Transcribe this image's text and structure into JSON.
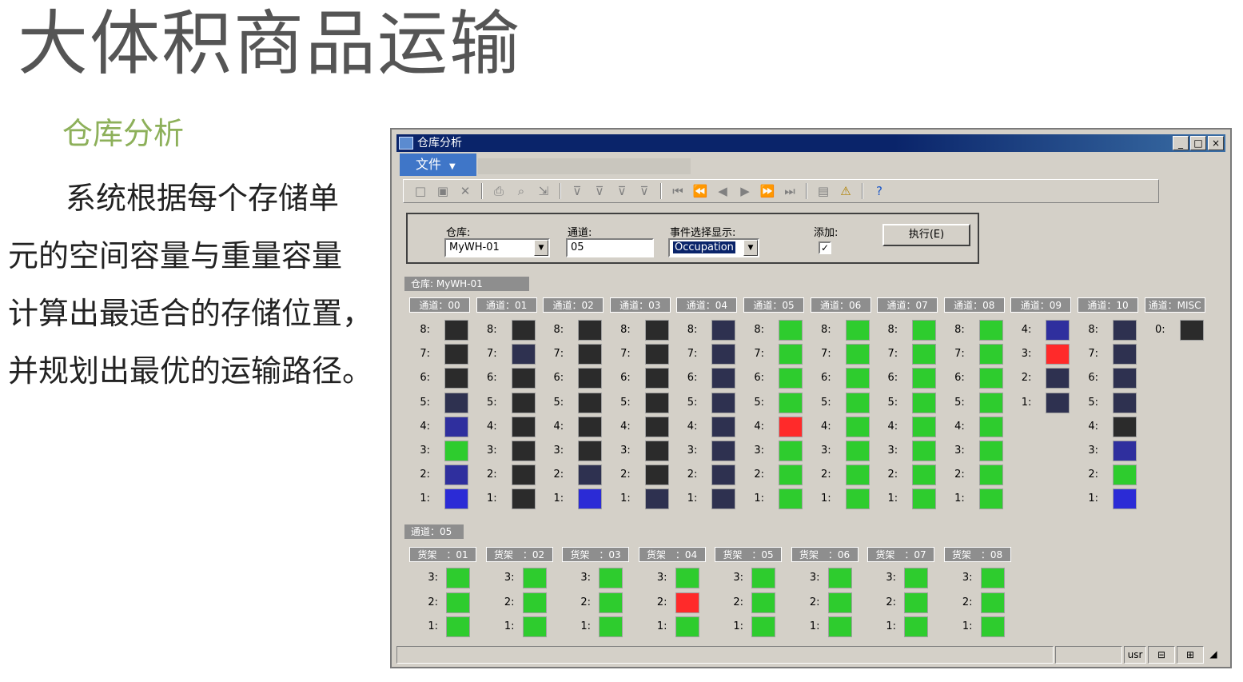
{
  "slide": {
    "title": "大体积商品运输",
    "subtitle": "仓库分析",
    "body_lines": [
      "系统根据每个存储单",
      "元的空间容量与重量容量",
      "计算出最适合的存储位置，",
      "并规划出最优的运输路径。"
    ]
  },
  "window": {
    "title": "仓库分析",
    "menu": {
      "file": "文件"
    },
    "controls": [
      "_",
      "□",
      "×"
    ]
  },
  "toolbar": {
    "icons": [
      "new-icon",
      "save-icon",
      "delete-icon",
      "|",
      "print-icon",
      "print-preview-icon",
      "export-icon",
      "|",
      "filter-icon",
      "filter-add-icon",
      "filter-edit-icon",
      "filter-remove-icon",
      "|",
      "first-icon",
      "prev-page-icon",
      "prev-icon",
      "next-icon",
      "next-page-icon",
      "last-icon",
      "|",
      "clipboard-icon",
      "alert-icon",
      "|",
      "help-icon"
    ]
  },
  "filter": {
    "warehouse_label": "仓库:",
    "warehouse_value": "MyWH-01",
    "aisle_label": "通道:",
    "aisle_value": "05",
    "event_label": "事件选择显示:",
    "event_value": "Occupation",
    "add_label": "添加:",
    "add_checked": true,
    "execute_label": "执行(E)"
  },
  "colors": {
    "dark": "#2b2b2b",
    "navy": "#2e3150",
    "blue": "#2f2f9e",
    "bright_blue": "#2b2bd6",
    "green": "#2ecc2e",
    "red": "#ff2a2a"
  },
  "warehouse_section": {
    "title": "仓库: MyWH-01",
    "aisles": [
      {
        "label": "通道：00",
        "levels": [
          8,
          7,
          6,
          5,
          4,
          3,
          2,
          1
        ],
        "status": [
          "dark",
          "dark",
          "dark",
          "navy",
          "blue",
          "green",
          "blue",
          "bright_blue"
        ]
      },
      {
        "label": "通道：01",
        "levels": [
          8,
          7,
          6,
          5,
          4,
          3,
          2,
          1
        ],
        "status": [
          "dark",
          "navy",
          "dark",
          "dark",
          "dark",
          "dark",
          "dark",
          "dark"
        ]
      },
      {
        "label": "通道：02",
        "levels": [
          8,
          7,
          6,
          5,
          4,
          3,
          2,
          1
        ],
        "status": [
          "dark",
          "dark",
          "dark",
          "dark",
          "dark",
          "dark",
          "navy",
          "bright_blue"
        ]
      },
      {
        "label": "通道：03",
        "levels": [
          8,
          7,
          6,
          5,
          4,
          3,
          2,
          1
        ],
        "status": [
          "dark",
          "dark",
          "dark",
          "dark",
          "dark",
          "dark",
          "dark",
          "navy"
        ]
      },
      {
        "label": "通道：04",
        "levels": [
          8,
          7,
          6,
          5,
          4,
          3,
          2,
          1
        ],
        "status": [
          "navy",
          "navy",
          "navy",
          "navy",
          "navy",
          "navy",
          "navy",
          "navy"
        ]
      },
      {
        "label": "通道：05",
        "levels": [
          8,
          7,
          6,
          5,
          4,
          3,
          2,
          1
        ],
        "status": [
          "green",
          "green",
          "green",
          "green",
          "red",
          "green",
          "green",
          "green"
        ]
      },
      {
        "label": "通道：06",
        "levels": [
          8,
          7,
          6,
          5,
          4,
          3,
          2,
          1
        ],
        "status": [
          "green",
          "green",
          "green",
          "green",
          "green",
          "green",
          "green",
          "green"
        ]
      },
      {
        "label": "通道：07",
        "levels": [
          8,
          7,
          6,
          5,
          4,
          3,
          2,
          1
        ],
        "status": [
          "green",
          "green",
          "green",
          "green",
          "green",
          "green",
          "green",
          "green"
        ]
      },
      {
        "label": "通道：08",
        "levels": [
          8,
          7,
          6,
          5,
          4,
          3,
          2,
          1
        ],
        "status": [
          "green",
          "green",
          "green",
          "green",
          "green",
          "green",
          "green",
          "green"
        ]
      },
      {
        "label": "通道：09",
        "levels": [
          4,
          3,
          2,
          1
        ],
        "status": [
          "blue",
          "red",
          "navy",
          "navy"
        ]
      },
      {
        "label": "通道：10",
        "levels": [
          8,
          7,
          6,
          5,
          4,
          3,
          2,
          1
        ],
        "status": [
          "navy",
          "navy",
          "navy",
          "navy",
          "dark",
          "blue",
          "green",
          "bright_blue"
        ]
      },
      {
        "label": "通道：MISC",
        "levels": [
          0
        ],
        "status": [
          "dark"
        ]
      }
    ]
  },
  "aisle_section": {
    "title": "通道：05",
    "racks": [
      {
        "label": "货架　：01",
        "levels": [
          3,
          2,
          1
        ],
        "status": [
          "green",
          "green",
          "green"
        ]
      },
      {
        "label": "货架　：02",
        "levels": [
          3,
          2,
          1
        ],
        "status": [
          "green",
          "green",
          "green"
        ]
      },
      {
        "label": "货架　：03",
        "levels": [
          3,
          2,
          1
        ],
        "status": [
          "green",
          "green",
          "green"
        ]
      },
      {
        "label": "货架　：04",
        "levels": [
          3,
          2,
          1
        ],
        "status": [
          "green",
          "red",
          "green"
        ]
      },
      {
        "label": "货架　：05",
        "levels": [
          3,
          2,
          1
        ],
        "status": [
          "green",
          "green",
          "green"
        ]
      },
      {
        "label": "货架　：06",
        "levels": [
          3,
          2,
          1
        ],
        "status": [
          "green",
          "green",
          "green"
        ]
      },
      {
        "label": "货架　：07",
        "levels": [
          3,
          2,
          1
        ],
        "status": [
          "green",
          "green",
          "green"
        ]
      },
      {
        "label": "货架　：08",
        "levels": [
          3,
          2,
          1
        ],
        "status": [
          "green",
          "green",
          "green"
        ]
      }
    ]
  },
  "statusbar": {
    "user": "usr"
  }
}
